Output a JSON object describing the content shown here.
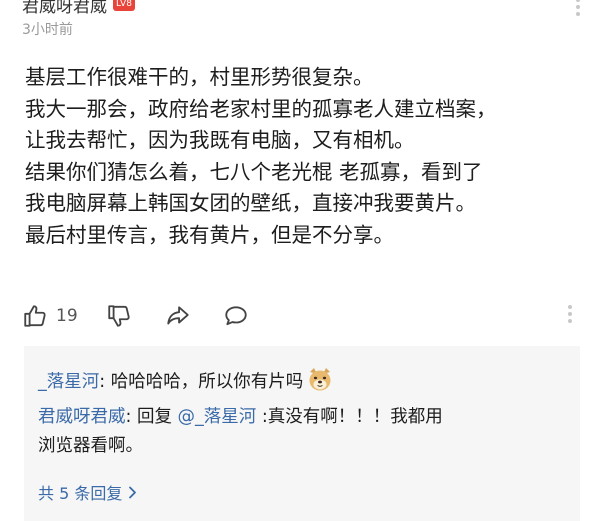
{
  "comment": {
    "username": "君威呀君威",
    "badge": "LV8",
    "time": "3小时前",
    "body": [
      "基层工作很难干的，村里形势很复杂。",
      "我大一那会，政府给老家村里的孤寡老人建立档案，",
      "让我去帮忙，因为我既有电脑，又有相机。",
      "结果你们猜怎么着，七八个老光棍 老孤寡，看到了",
      "我电脑屏幕上韩国女团的壁纸，直接冲我要黄片。",
      "最后村里传言，我有黄片，但是不分享。"
    ]
  },
  "actions": {
    "like_icon": "thumbs-up-icon",
    "like_count": "19",
    "dislike_icon": "thumbs-down-icon",
    "share_icon": "share-icon",
    "reply_icon": "comment-icon",
    "more_icon": "more-vertical-icon"
  },
  "replies": {
    "items": [
      {
        "author": "_落星河",
        "separator": ":",
        "text": " 哈哈哈哈，所以你有片吗",
        "emoji": "doge-emoji-icon"
      },
      {
        "author": "君威呀君威",
        "separator": ":",
        "reply_prefix": " 回复 ",
        "mention": "@_落星河",
        "text_line1": " :真没有啊！！！我都用",
        "text_line2": "浏览器看啊。"
      }
    ],
    "more_label": "共 5 条回复",
    "more_icon": "chevron-right-icon"
  },
  "colors": {
    "link": "#3b6aa8",
    "badge": "#e8443a",
    "reply_bg": "#f6f6f6",
    "muted": "#9a9a9a"
  }
}
